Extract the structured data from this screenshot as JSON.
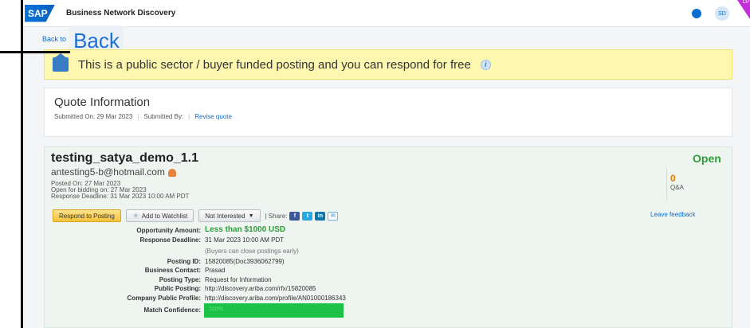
{
  "header": {
    "logo": "SAP",
    "title": "Business Network Discovery",
    "avatar_initials": "SD",
    "corner_badge": "CP"
  },
  "back": {
    "link_label": "Back to",
    "overlay_label": "Back"
  },
  "notice": {
    "text": "This is a public sector / buyer funded posting and you can respond for free",
    "info_glyph": "i"
  },
  "quote": {
    "title": "Quote Information",
    "submitted_on": "Submitted On: 29 Mar 2023",
    "submitted_by": "Submitted By:",
    "revise_link": "Revise quote"
  },
  "posting": {
    "title": "testing_satya_demo_1.1",
    "email": "antesting5-b@hotmail.com",
    "posted_on": "Posted On:  27 Mar 2023",
    "open_for_bidding": "Open for bidding on:  27 Mar 2023",
    "response_deadline": "Response Deadline:  31 Mar 2023 10:00 AM PDT",
    "status": "Open",
    "qa_count": "0",
    "qa_label": "Q&A",
    "actions": {
      "respond": "Respond to Posting",
      "watchlist": "Add to Watchlist",
      "not_interested": "Not Interested",
      "share": "| Share:",
      "feedback": "Leave feedback"
    },
    "details": {
      "opportunity_amount_label": "Opportunity Amount:",
      "opportunity_amount": "Less than $1000 USD",
      "deadline_label": "Response Deadline:",
      "deadline": "31 Mar 2023 10:00 AM PDT",
      "deadline_note": "(Buyers can close postings early)",
      "posting_id_label": "Posting ID:",
      "posting_id": "15820085(Doc3936062799)",
      "business_contact_label": "Business Contact:",
      "business_contact": "Prasad",
      "posting_type_label": "Posting Type:",
      "posting_type": "Request for Information",
      "public_posting_label": "Public Posting:",
      "public_posting": "http://discovery.ariba.com/rfx/15820085",
      "company_profile_label": "Company Public Profile:",
      "company_profile": "http://discovery.ariba.com/profile/AN01000186343",
      "match_label": "Match Confidence:",
      "match_value": "100%"
    }
  },
  "colors": {
    "accent": "#0a6ed1",
    "open_status": "#2e9d3a",
    "notice_bg": "#fdf7b0",
    "match_bar": "#1cc245"
  },
  "icons": [
    "sap-logo-icon",
    "globe-icon",
    "avatar-icon",
    "building-icon",
    "info-icon",
    "person-icon",
    "star-icon",
    "facebook-icon",
    "twitter-icon",
    "linkedin-icon",
    "mail-icon"
  ]
}
